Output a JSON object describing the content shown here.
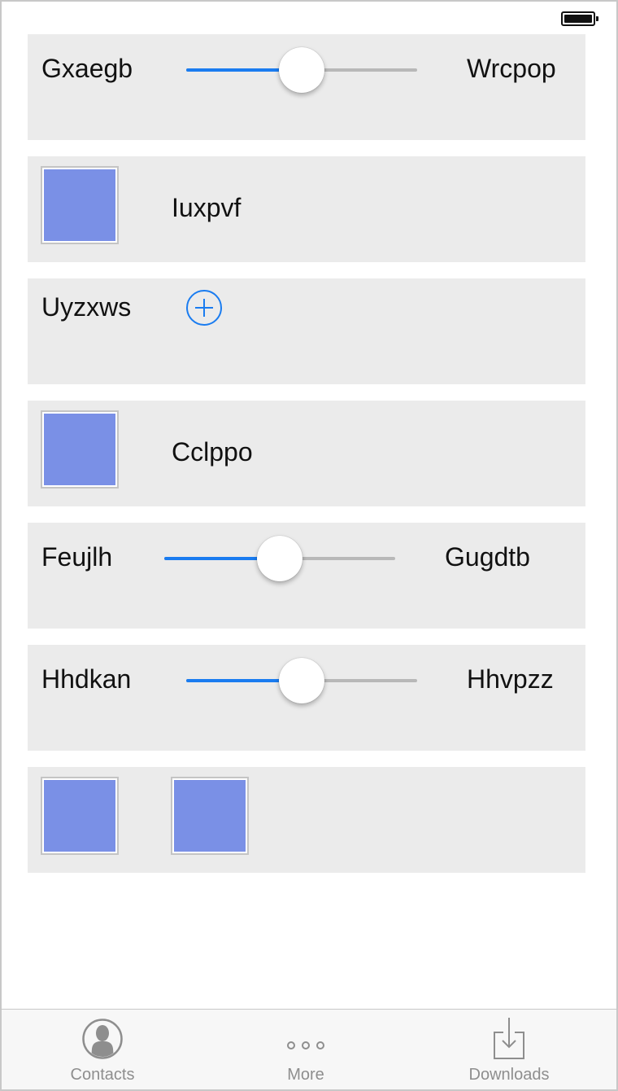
{
  "rows": [
    {
      "type": "slider",
      "left_label": "Gxaegb",
      "right_label": "Wrcpop",
      "value": 0.5
    },
    {
      "type": "swatch",
      "label": "Iuxpvf"
    },
    {
      "type": "add",
      "label": "Uyzxws"
    },
    {
      "type": "swatch",
      "label": "Cclppo"
    },
    {
      "type": "slider",
      "left_label": "Feujlh",
      "right_label": "Gugdtb",
      "value": 0.5
    },
    {
      "type": "slider",
      "left_label": "Hhdkan",
      "right_label": "Hhvpzz",
      "value": 0.5
    },
    {
      "type": "swatches"
    }
  ],
  "colors": {
    "accent": "#1a7cf0",
    "row_bg": "#ebebeb",
    "swatch": "#7a90e6",
    "tab_inactive": "#8e8e8e"
  },
  "tabbar": {
    "tabs": [
      {
        "label": "Contacts",
        "icon": "contacts-icon"
      },
      {
        "label": "More",
        "icon": "more-icon"
      },
      {
        "label": "Downloads",
        "icon": "downloads-icon"
      }
    ]
  }
}
